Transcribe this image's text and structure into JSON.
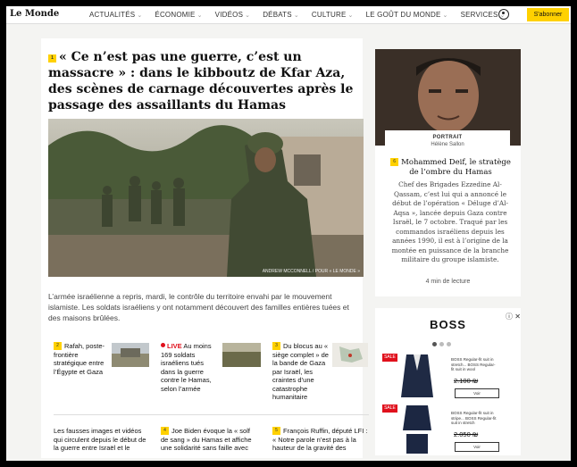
{
  "header": {
    "logo": "Le Monde",
    "nav": [
      "ACTUALITÉS",
      "ÉCONOMIE",
      "VIDÉOS",
      "DÉBATS",
      "CULTURE",
      "LE GOÛT DU MONDE",
      "SERVICES"
    ],
    "subscribe_label": "S'abonner"
  },
  "main": {
    "tag": "1",
    "headline": "« Ce n’est pas une guerre, c’est un massacre » : dans le kibboutz de Kfar Aza, des scènes de carnage découvertes après le passage des assaillants du Hamas",
    "photo_credit": "ANDREW MCCONNELL / POUR « LE MONDE »",
    "lede": "L’armée israélienne a repris, mardi, le contrôle du territoire envahi par le mouvement islamiste. Les soldats israéliens y ont notamment découvert des familles entières tuées et des maisons brûlées."
  },
  "cards": [
    {
      "tag": "2",
      "text": "Rafah, poste-frontière stratégique entre l’Égypte et Gaza"
    },
    {
      "live": "LIVE",
      "text": "Au moins 169 soldats israéliens tués dans la guerre contre le Hamas, selon l’armée"
    },
    {
      "tag": "3",
      "text": "Du blocus au « siège complet » de la bande de Gaza par Israël, les craintes d’une catastrophe humanitaire"
    },
    {
      "text": "Les fausses images et vidéos qui circulent depuis le début de la guerre entre Israël et le"
    },
    {
      "tag": "4",
      "text": "Joe Biden évoque la « solf de sang » du Hamas et affiche une solidarité sans faille avec"
    },
    {
      "tag": "5",
      "text": "François Ruffin, député LFI : « Notre parole n’est pas à la hauteur de la gravité des"
    }
  ],
  "sidebar": {
    "kicker": "PORTRAIT",
    "author": "Hélène Sallon",
    "tag": "6",
    "title": "Mohammed Deif, le stratège de l’ombre du Hamas",
    "description": "Chef des Brigades Ezzedine Al-Qassam, c’est lui qui a annoncé le début de l’opération « Déluge d’Al-Aqsa », lancée depuis Gaza contre Israël, le 7 octobre. Traqué par les commandos israéliens depuis les années 1990, il est à l’origine de la montée en puissance de la branche militaire du groupe islamiste.",
    "read_time": "4 min de lecture"
  },
  "ad": {
    "brand": "BOSS",
    "close": "ⓘ ✕",
    "products": [
      {
        "sale": "SALE",
        "desc": "BOSS Regular-fit suit in stretch... BOSS Regular-fit suit in wool",
        "price": "2.100 ₪",
        "button": "Voir"
      },
      {
        "sale": "SALE",
        "desc": "BOSS Regular-fit suit in stripe... BOSS Regular-fit suit in stretch",
        "price": "2.050 ₪",
        "button": "Voir"
      }
    ]
  },
  "colors": {
    "accent": "#ffd100",
    "live": "#e0101c",
    "page_bg": "#f4f4f2"
  }
}
